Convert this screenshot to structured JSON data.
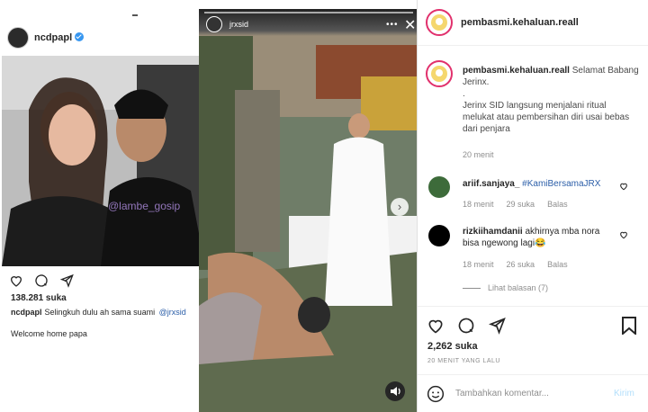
{
  "left_post": {
    "username": "ncdpapl",
    "likes": "138.281 suka",
    "caption_user": "ncdpapl",
    "caption_text": "Selingkuh dulu ah sama suami",
    "caption_mention": "@jrxsid",
    "comment": "Welcome home papa",
    "watermark": "@lambe_gosip"
  },
  "story": {
    "username": "jrxsid",
    "more": "•••",
    "close": "✕",
    "next": "›"
  },
  "right_panel": {
    "header_username": "pembasmi.kehaluan.reall",
    "caption": {
      "username": "pembasmi.kehaluan.reall",
      "line1": "Selamat Babang Jerinx.",
      "dot": ".",
      "body": "Jerinx SID langsung menjalani ritual melukat atau pembersihan diri usai bebas dari penjara",
      "time": "20 menit"
    },
    "comments": [
      {
        "username": "ariif.sanjaya_",
        "text": "#KamiBersamaJRX",
        "time": "18 menit",
        "likes": "29 suka",
        "reply": "Balas"
      },
      {
        "username": "rizkiihamdanii",
        "text": "akhirnya mba nora bisa ngewong lagi😂",
        "time": "18 menit",
        "likes": "26 suka",
        "reply": "Balas"
      }
    ],
    "view_replies": "Lihat balasan (7)",
    "likes": "2,262 suka",
    "time_ago": "20 MENIT YANG LALU",
    "input_placeholder": "Tambahkan komentar...",
    "post_label": "Kirim"
  },
  "colors": {
    "link": "#2b5ea8",
    "muted": "#8e8e8e",
    "post_disabled": "#b2dffc",
    "verified": "#3897f0"
  }
}
